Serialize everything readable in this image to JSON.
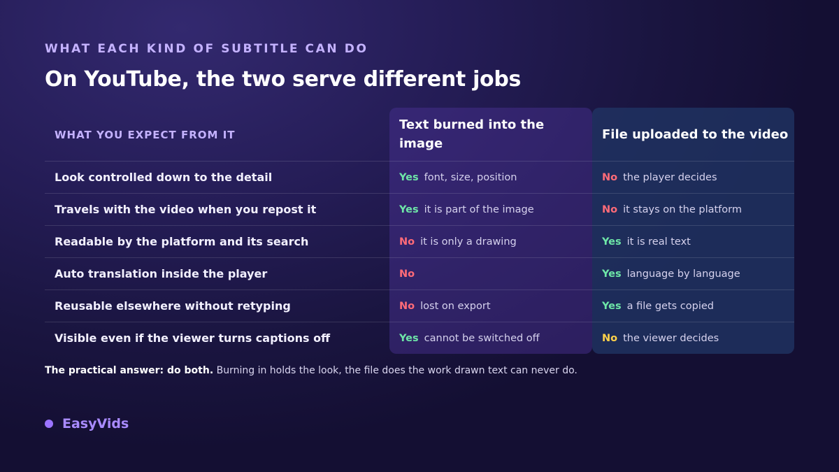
{
  "eyebrow": "WHAT EACH KIND OF SUBTITLE CAN DO",
  "title": "On YouTube, the two serve different jobs",
  "table": {
    "header_label": "WHAT YOU EXPECT FROM IT",
    "col_burned": "Text burned into the image",
    "col_file": "File uploaded to the video",
    "rows": [
      {
        "label": "Look controlled down to the detail",
        "burned": {
          "verdict": "Yes",
          "tone": "yes",
          "note": "font, size, position"
        },
        "file": {
          "verdict": "No",
          "tone": "no",
          "note": "the player decides"
        }
      },
      {
        "label": "Travels with the video when you repost it",
        "burned": {
          "verdict": "Yes",
          "tone": "yes",
          "note": "it is part of the image"
        },
        "file": {
          "verdict": "No",
          "tone": "no",
          "note": "it stays on the platform"
        }
      },
      {
        "label": "Readable by the platform and its search",
        "burned": {
          "verdict": "No",
          "tone": "no",
          "note": "it is only a drawing"
        },
        "file": {
          "verdict": "Yes",
          "tone": "yes",
          "note": "it is real text"
        }
      },
      {
        "label": "Auto translation inside the player",
        "burned": {
          "verdict": "No",
          "tone": "no",
          "note": ""
        },
        "file": {
          "verdict": "Yes",
          "tone": "yes",
          "note": "language by language"
        }
      },
      {
        "label": "Reusable elsewhere without retyping",
        "burned": {
          "verdict": "No",
          "tone": "no",
          "note": "lost on export"
        },
        "file": {
          "verdict": "Yes",
          "tone": "yes",
          "note": "a file gets copied"
        }
      },
      {
        "label": "Visible even if the viewer turns captions off",
        "burned": {
          "verdict": "Yes",
          "tone": "yes",
          "note": "cannot be switched off"
        },
        "file": {
          "verdict": "No",
          "tone": "warn",
          "note": "the viewer decides"
        }
      }
    ]
  },
  "footnote": {
    "bold": "The practical answer: do both.",
    "rest": " Burning in holds the look, the file does the work drawn text can never do."
  },
  "brand": {
    "name": "EasyVids"
  },
  "colors": {
    "yes": "#6ee7a8",
    "no": "#ff6b78",
    "warn": "#ffd24a",
    "accent": "#9b74ff"
  }
}
